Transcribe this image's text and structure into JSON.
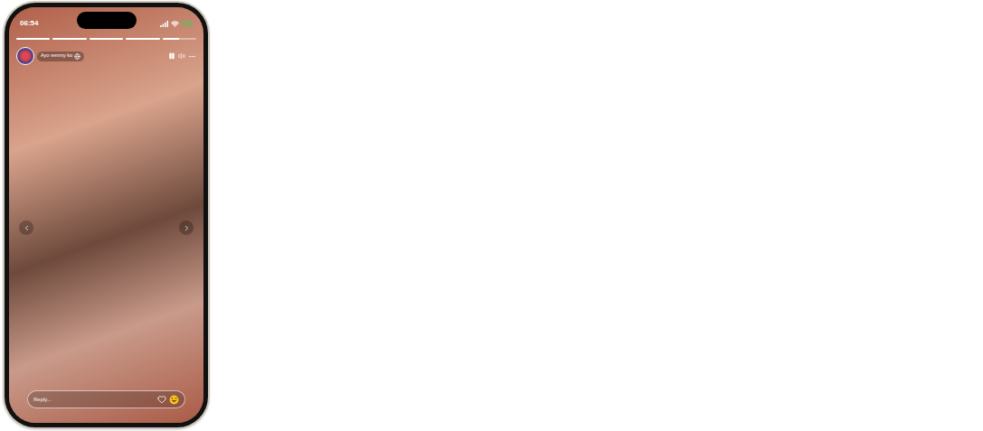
{
  "status_bar": {
    "time": "06:54"
  },
  "story": {
    "progress": [
      {
        "level": 1
      },
      {
        "level": 1
      },
      {
        "level": 1
      },
      {
        "level": 1
      },
      {
        "level": 0.5
      }
    ],
    "user": {
      "name": "Ayo remmy ko"
    }
  },
  "reply": {
    "placeholder": "Reply..."
  }
}
